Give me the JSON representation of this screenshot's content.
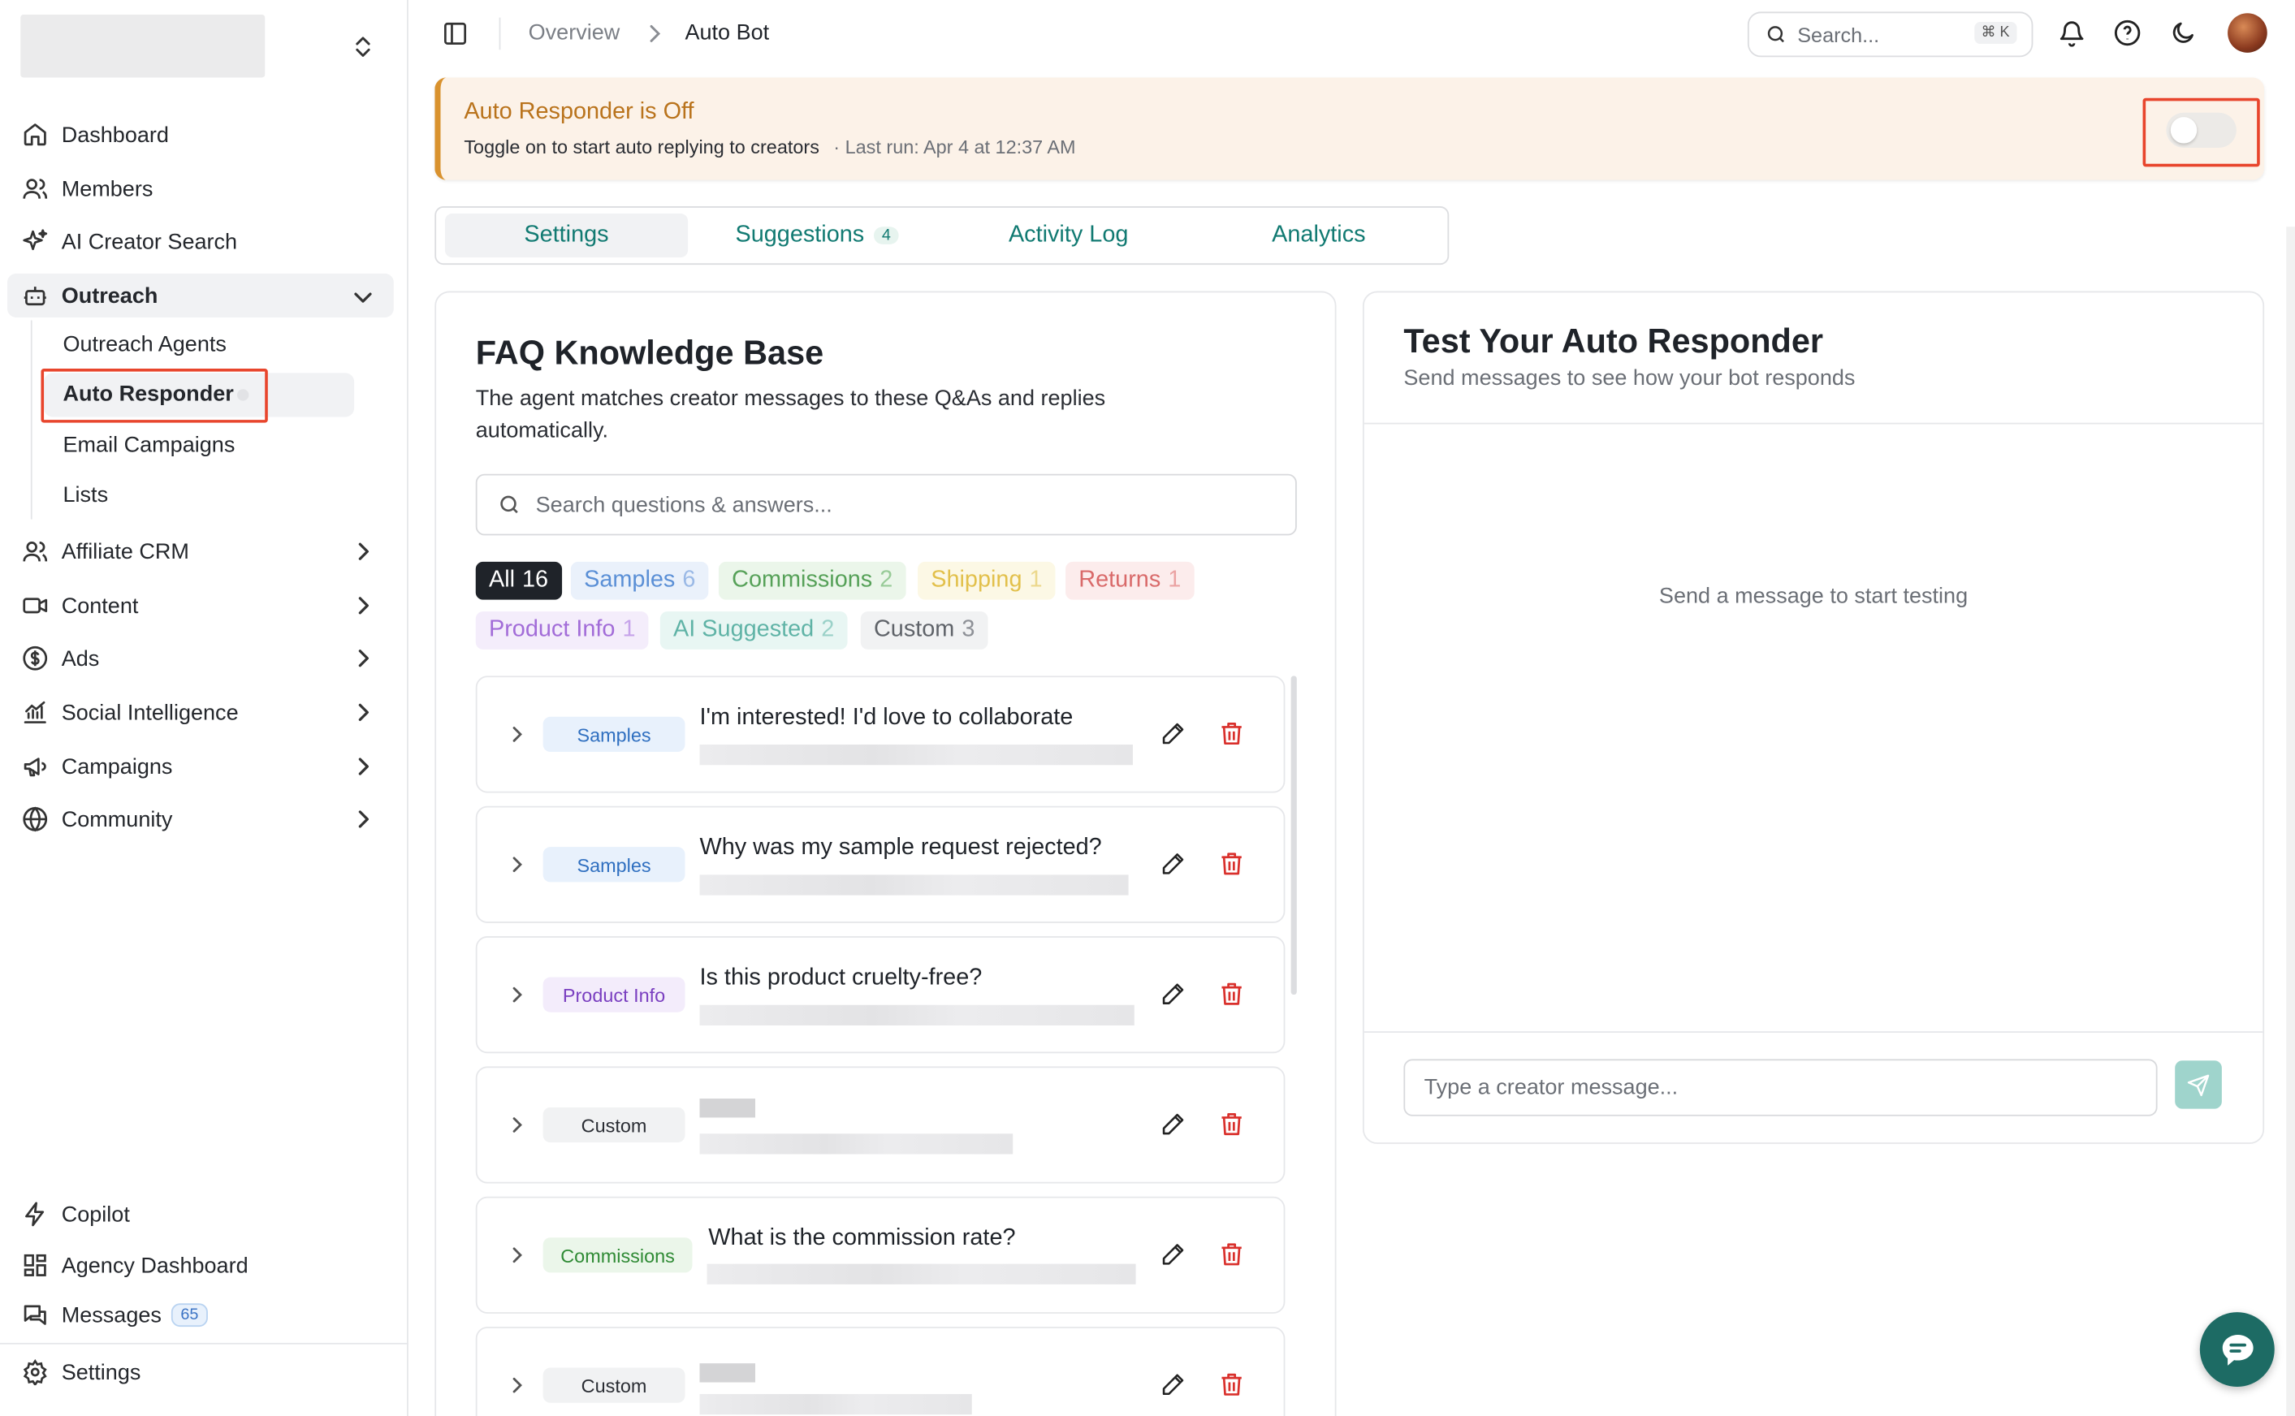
{
  "header": {
    "breadcrumb": [
      "Overview",
      "Auto Bot"
    ],
    "search_placeholder": "Search...",
    "search_shortcut": "⌘ K"
  },
  "sidebar": {
    "main": [
      {
        "label": "Dashboard",
        "icon": "home-icon"
      },
      {
        "label": "Members",
        "icon": "users-icon"
      },
      {
        "label": "AI Creator Search",
        "icon": "sparkles-icon"
      },
      {
        "label": "Outreach",
        "icon": "bot-icon",
        "expanded": true
      }
    ],
    "outreach_sub": [
      "Outreach Agents",
      "Auto Responder",
      "Email Campaigns",
      "Lists"
    ],
    "groups": [
      "Affiliate CRM",
      "Content",
      "Ads",
      "Social Intelligence",
      "Campaigns",
      "Community"
    ],
    "bottom": {
      "copilot": "Copilot",
      "agency_dashboard": "Agency Dashboard",
      "messages": "Messages",
      "messages_count": "65",
      "settings": "Settings"
    }
  },
  "banner": {
    "title": "Auto Responder is Off",
    "subtitle": "Toggle on to start auto replying to creators",
    "last_run": "· Last run: Apr 4 at 12:37 AM",
    "toggle_on": false,
    "accent": "#d9922e"
  },
  "tabs": [
    {
      "label": "Settings",
      "active": true
    },
    {
      "label": "Suggestions",
      "count": "4"
    },
    {
      "label": "Activity Log"
    },
    {
      "label": "Analytics"
    }
  ],
  "faq": {
    "title": "FAQ Knowledge Base",
    "description": "The agent matches creator messages to these Q&As and replies automatically.",
    "search_placeholder": "Search questions & answers...",
    "filters": [
      {
        "label": "All",
        "count": "16"
      },
      {
        "label": "Samples",
        "count": "6"
      },
      {
        "label": "Commissions",
        "count": "2"
      },
      {
        "label": "Shipping",
        "count": "1"
      },
      {
        "label": "Returns",
        "count": "1"
      },
      {
        "label": "Product Info",
        "count": "1"
      },
      {
        "label": "AI Suggested",
        "count": "2"
      },
      {
        "label": "Custom",
        "count": "3"
      }
    ],
    "items": [
      {
        "category": "Samples",
        "question": "I'm interested! I'd love to collaborate"
      },
      {
        "category": "Samples",
        "question": "Why was my sample request rejected?"
      },
      {
        "category": "Product Info",
        "question": "Is this product cruelty-free?"
      },
      {
        "category": "Custom",
        "question": ""
      },
      {
        "category": "Commissions",
        "question": "What is the commission rate?"
      },
      {
        "category": "Custom",
        "question": ""
      }
    ]
  },
  "test": {
    "title": "Test Your Auto Responder",
    "subtitle": "Send messages to see how your bot responds",
    "empty": "Send a message to start testing",
    "input_placeholder": "Type a creator message..."
  },
  "colors": {
    "brand": "#117a72",
    "send_button": "#9fd4cc",
    "chat_fab": "#1d6b64"
  }
}
